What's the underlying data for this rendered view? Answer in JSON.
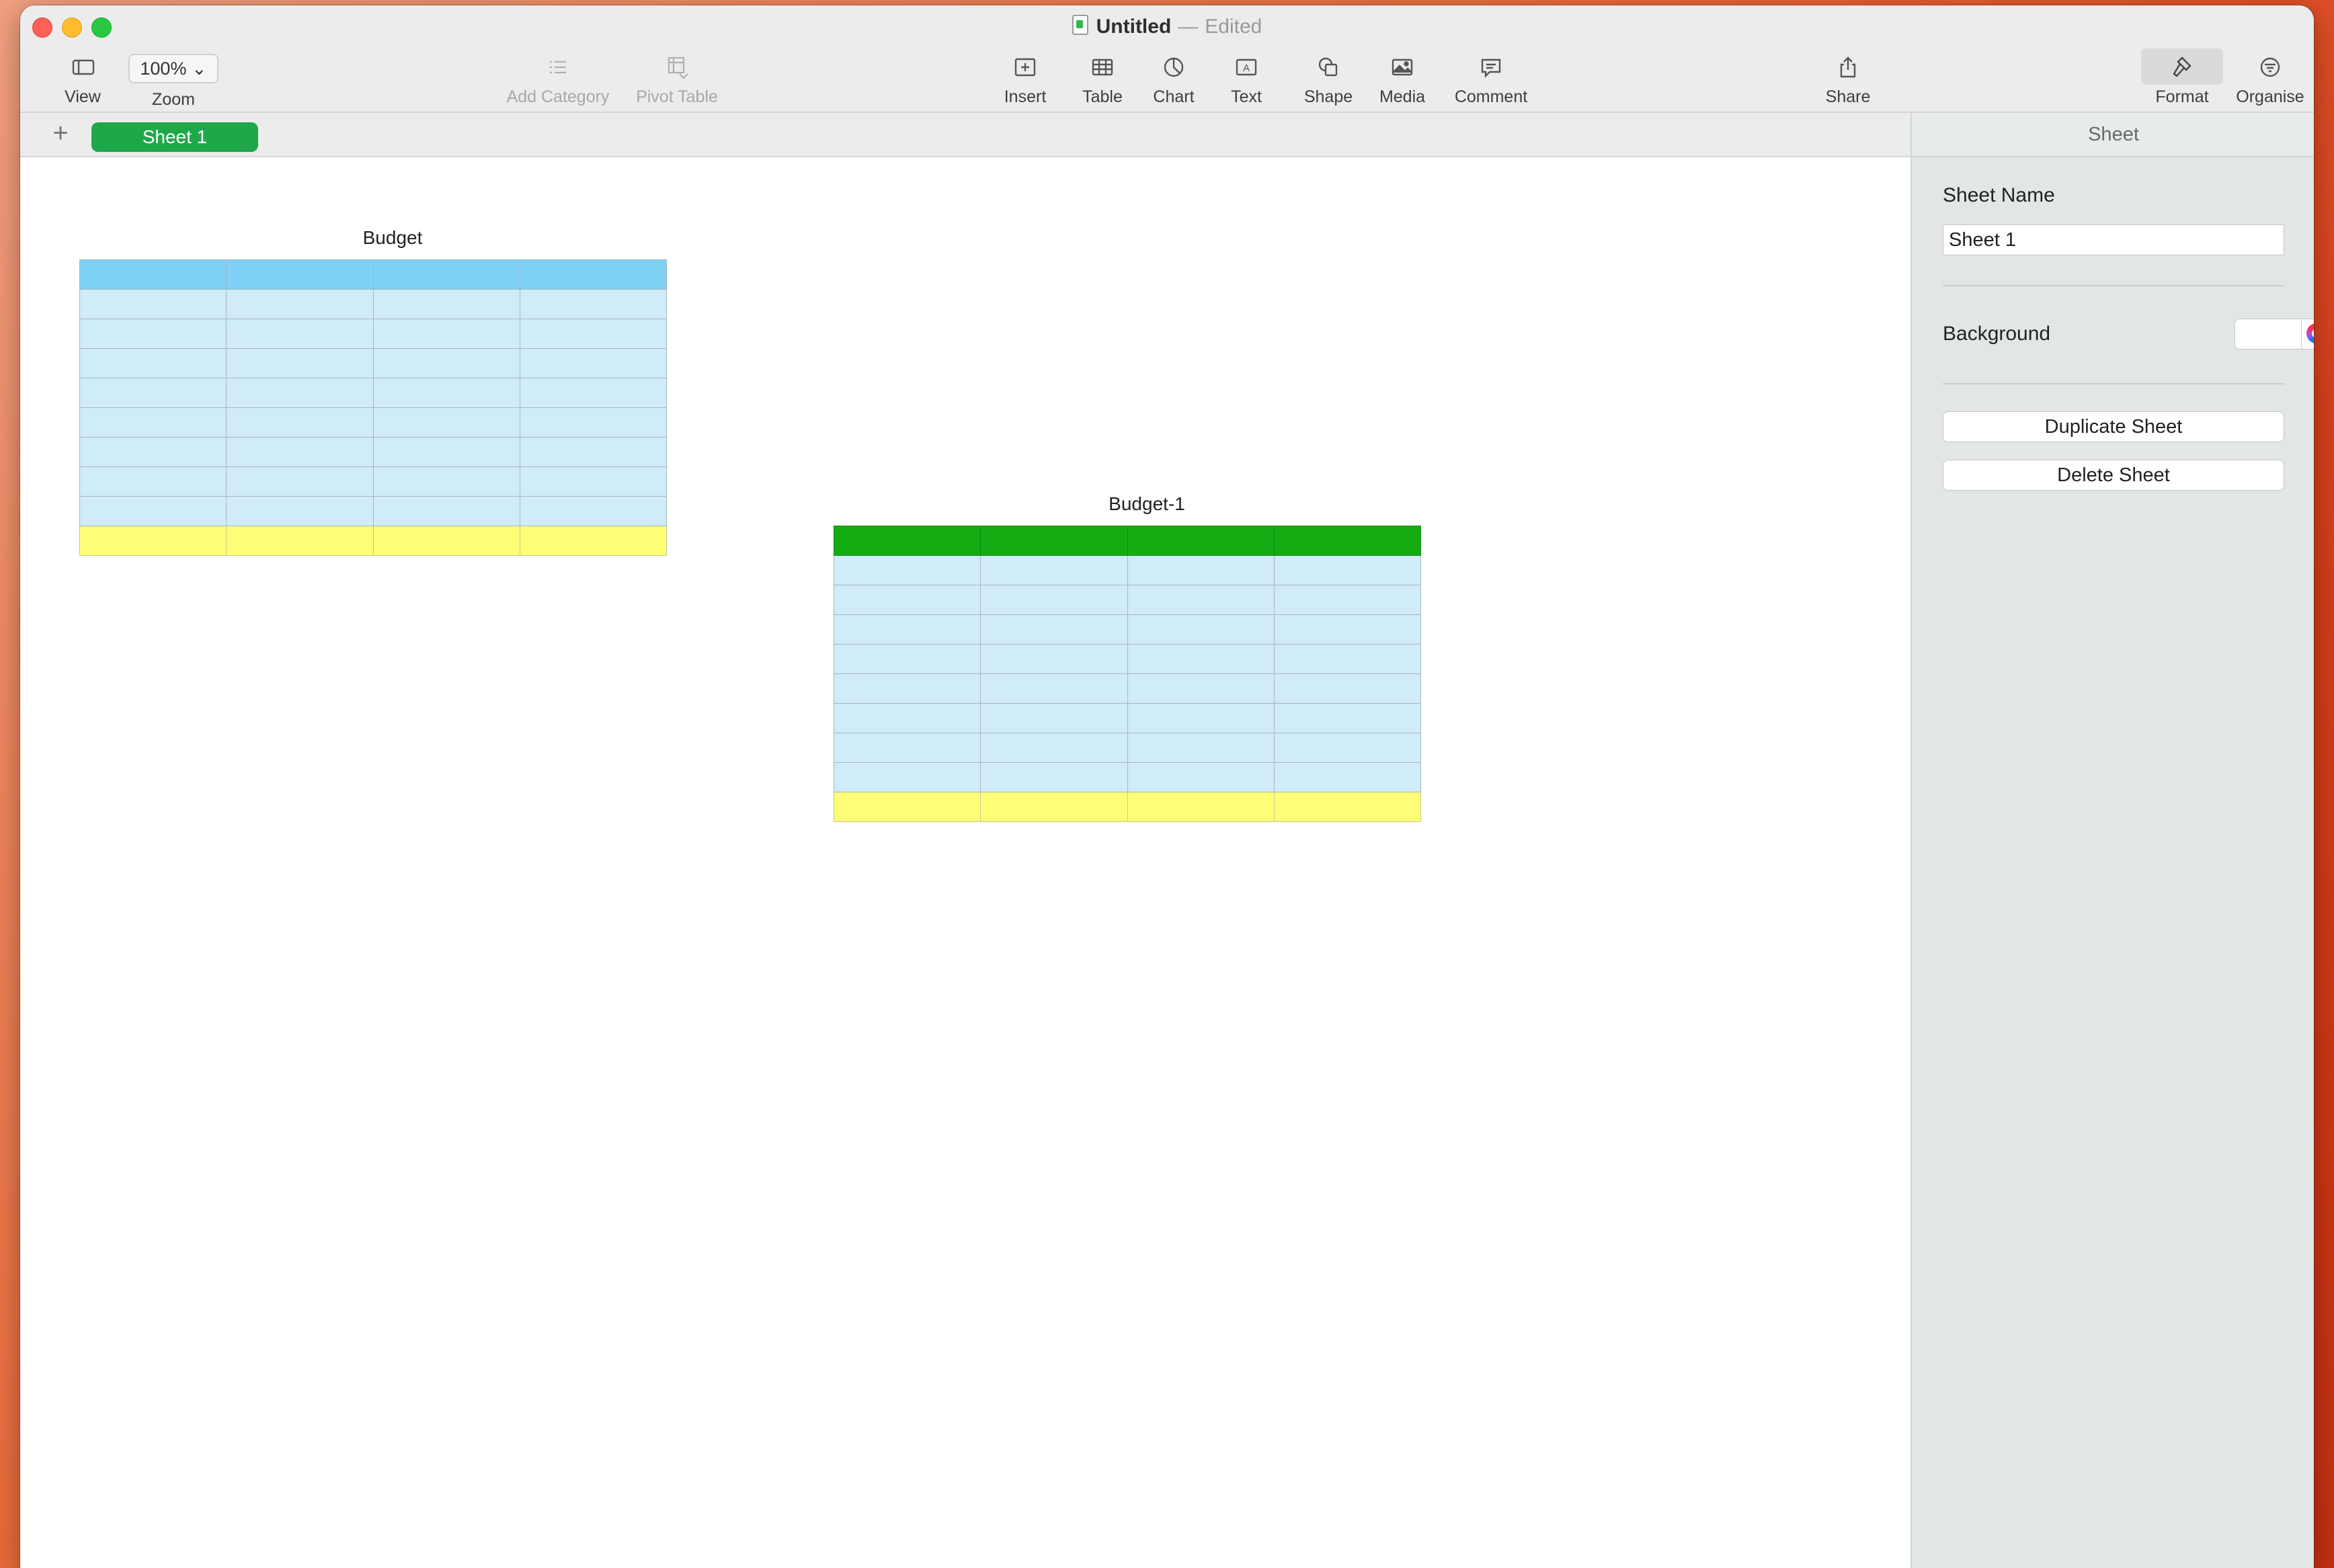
{
  "window": {
    "title": "Untitled",
    "status": "Edited"
  },
  "toolbar": {
    "view": {
      "label": "View",
      "icon": "sidebar-icon"
    },
    "zoom": {
      "label": "Zoom",
      "value": "100%",
      "icon": "chevron-down-icon"
    },
    "add_category": {
      "label": "Add Category",
      "icon": "list-icon",
      "enabled": false
    },
    "pivot_table": {
      "label": "Pivot Table",
      "icon": "pivot-table-icon",
      "enabled": false
    },
    "insert": {
      "label": "Insert",
      "icon": "insert-icon"
    },
    "table": {
      "label": "Table",
      "icon": "table-icon"
    },
    "chart": {
      "label": "Chart",
      "icon": "pie-chart-icon"
    },
    "text": {
      "label": "Text",
      "icon": "text-box-icon"
    },
    "shape": {
      "label": "Shape",
      "icon": "shape-icon"
    },
    "media": {
      "label": "Media",
      "icon": "photo-icon"
    },
    "comment": {
      "label": "Comment",
      "icon": "comment-icon"
    },
    "share": {
      "label": "Share",
      "icon": "share-icon"
    },
    "format": {
      "label": "Format",
      "icon": "paintbrush-icon",
      "selected": true
    },
    "organise": {
      "label": "Organise",
      "icon": "filter-icon"
    }
  },
  "tabs": {
    "add_label": "+",
    "sheets": [
      {
        "label": "Sheet 1",
        "active": true
      }
    ]
  },
  "canvas": {
    "tables": [
      {
        "title": "Budget",
        "header_color": "#7ed0f5",
        "columns": 4,
        "body_rows": 8,
        "has_footer": true
      },
      {
        "title": "Budget-1",
        "header_color": "#14ac12",
        "columns": 4,
        "body_rows": 8,
        "has_footer": true
      }
    ]
  },
  "inspector": {
    "header": "Sheet",
    "sheet_name_label": "Sheet Name",
    "sheet_name_value": "Sheet 1",
    "background_label": "Background",
    "background_color": "#ffffff",
    "duplicate_label": "Duplicate Sheet",
    "delete_label": "Delete Sheet"
  },
  "colors": {
    "accent_green": "#1fa84a",
    "body_cell": "#cfecf8",
    "footer_cell": "#ffff77"
  }
}
